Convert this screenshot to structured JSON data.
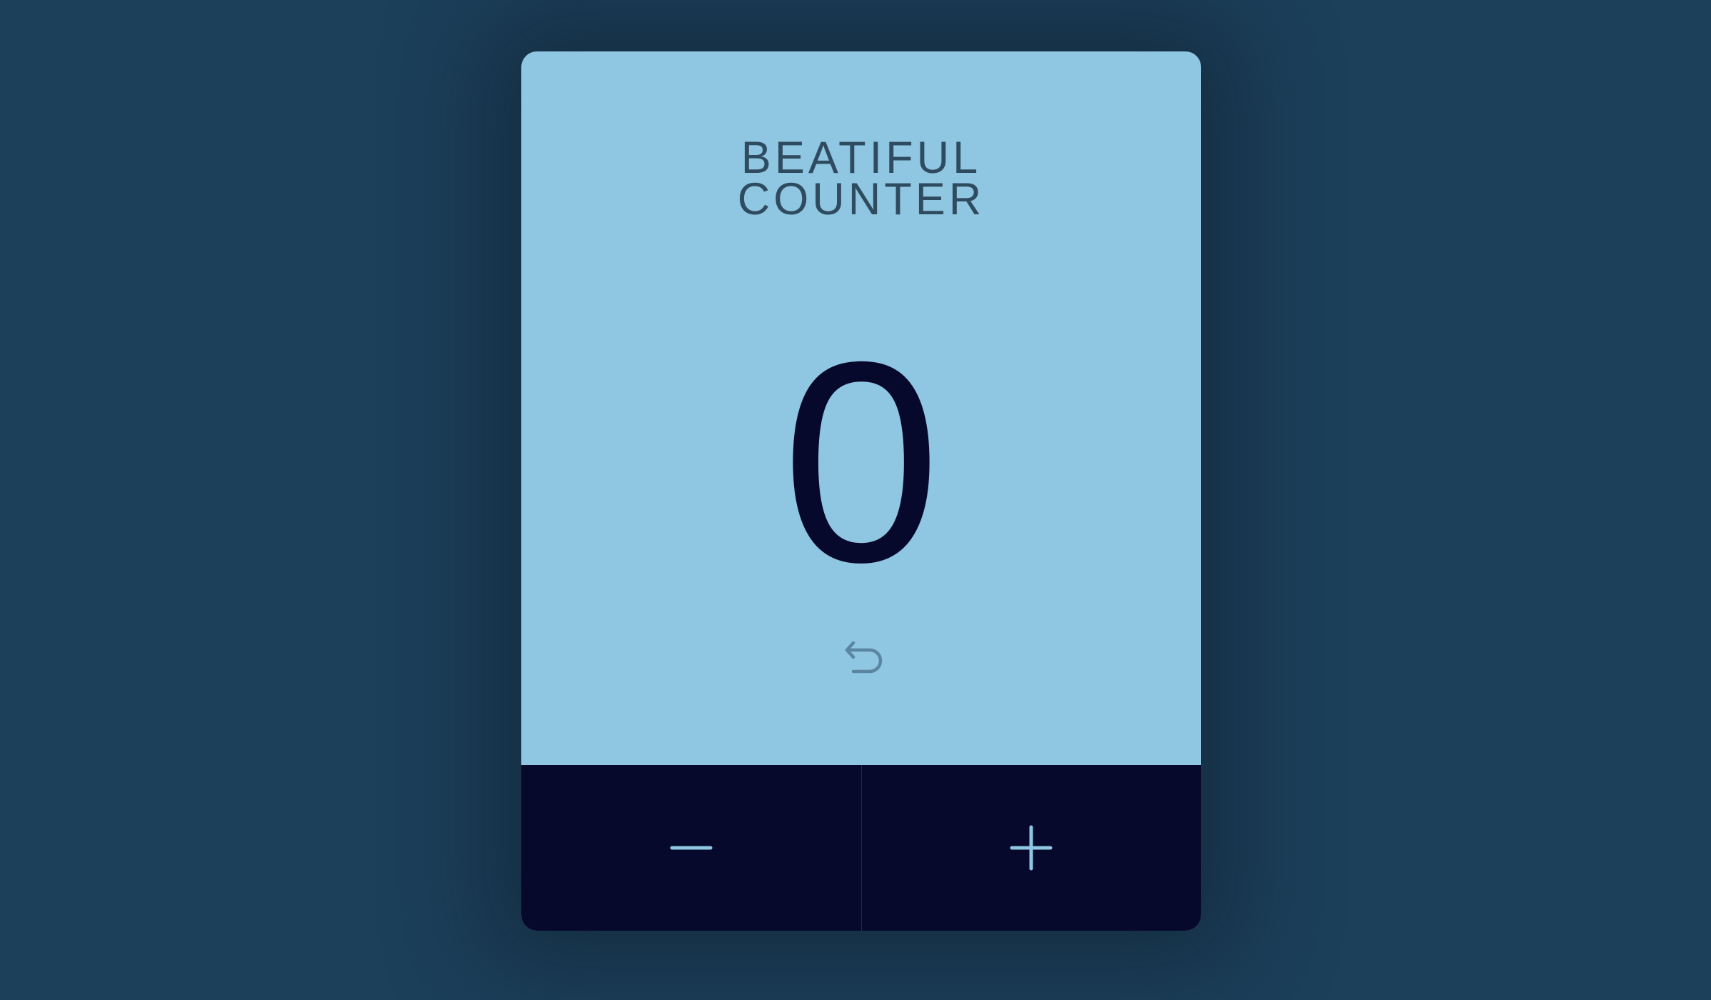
{
  "counter": {
    "title_line1": "BEATIFUL",
    "title_line2": "COUNTER",
    "value": "0"
  },
  "icons": {
    "reset": "undo-arrow-icon",
    "decrement": "minus-icon",
    "increment": "plus-icon"
  },
  "colors": {
    "page_background": "#1c3f5a",
    "card_background": "#8fc6e1",
    "controls_background": "#06092c",
    "count_text": "#06092c",
    "title_text": "#2f4b5f",
    "icon_accent": "#8fc6e1",
    "reset_icon": "#5b86a1"
  }
}
